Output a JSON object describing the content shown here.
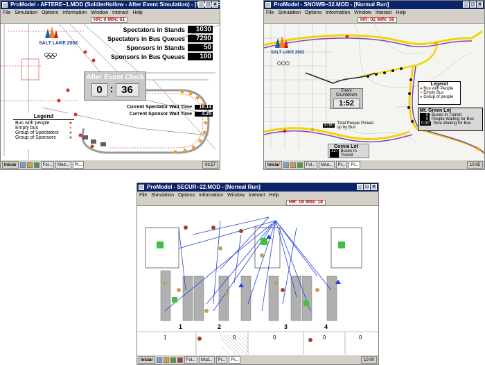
{
  "window1": {
    "title": "ProModel - AFTERE~1.MOD (SoldierHollow - After Event Simulation) - [Normal Run]",
    "menus": [
      "File",
      "Simulation",
      "Options",
      "Information",
      "Window",
      "Interact",
      "Help"
    ],
    "clock": "HR: 0 MIN: 51",
    "logo": {
      "line1": "SALT LAKE 2002"
    },
    "stats": [
      {
        "label": "Spectators in Stands",
        "value": "1030"
      },
      {
        "label": "Spectators in Bus Queues",
        "value": "7290"
      },
      {
        "label": "Sponsors in Stands",
        "value": "50"
      },
      {
        "label": "Sponsors in Bus Queues",
        "value": "100"
      }
    ],
    "clock_panel": {
      "title": "After Event Clock",
      "min": "0",
      "sec": "36"
    },
    "wait": [
      {
        "label": "Current Spectator Wait Time",
        "value": "19.14"
      },
      {
        "label": "Current Sponsor Wait Time",
        "value": "4.25"
      }
    ],
    "legend": {
      "title": "Legend",
      "items": [
        "Bus with people",
        "Empty bus",
        "Group of Spectators",
        "Group of Sponsors"
      ]
    },
    "taskbar": {
      "start": "Iniciar",
      "tasks": [
        "Fol...",
        "Mod...",
        "Pr..."
      ],
      "time": "03:57"
    }
  },
  "window2": {
    "title": "ProModel - SNOWB~32.MOD - [Normal Run]",
    "menus": [
      "File",
      "Simulation",
      "Options",
      "Information",
      "Window",
      "Interact",
      "Help"
    ],
    "clock": "HR: 02 MIN: 06",
    "logo": {
      "line1": "SALT LAKE 2002"
    },
    "event_clock": {
      "title": "Event Countdown",
      "value": "1:52"
    },
    "picked_up": {
      "value": "8190",
      "label": "Total People Picked up by Bus"
    },
    "legend": {
      "title": "Legend",
      "items": [
        "Bus with People",
        "Empty Bus",
        "Group of people"
      ]
    },
    "lot": {
      "title": "Mt. Green Lot",
      "rows": [
        {
          "value": "0",
          "label": "Buses In Transit"
        },
        {
          "value": "0",
          "label": "People Waiting for Bus"
        },
        {
          "value": "0.00",
          "label": "Time Waiting for Bus"
        }
      ]
    },
    "comlot": {
      "title": "Cornia Lot",
      "value": "127",
      "label": "Buses In Transit"
    },
    "taskbar": {
      "start": "Iniciar",
      "tasks": [
        "Fol...",
        "Mod...",
        "Pr...",
        "Pr..."
      ],
      "time": "10:05"
    }
  },
  "window3": {
    "title": "ProModel - SECUR~22.MOD - [Normal Run]",
    "menus": [
      "File",
      "Simulation",
      "Options",
      "Information",
      "Window",
      "Interact",
      "Help"
    ],
    "clock": "HR: 00 MIN: 18",
    "lanes": [
      "1",
      "2",
      "3",
      "4"
    ],
    "zone_counts": [
      "1",
      "0",
      "0",
      "0",
      "0"
    ],
    "taskbar": {
      "start": "Iniciar",
      "tasks": [
        "Fol...",
        "Mod...",
        "Pr...",
        "Pr..."
      ],
      "time": "10:00"
    }
  },
  "colors": {
    "titlebar": "#0a246a",
    "bus_with_people": "#d03020",
    "empty_bus": "#f0a020",
    "route_yellow": "#f2d500",
    "route_purple": "#8040c0",
    "arrow_blue": "#2040e0"
  }
}
